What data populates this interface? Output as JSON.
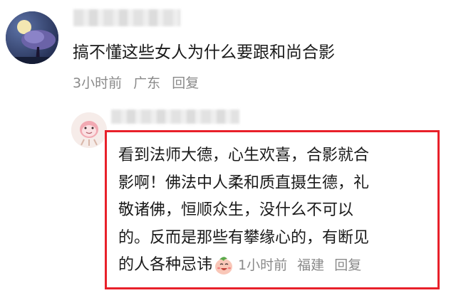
{
  "main_comment": {
    "text": "搞不懂这些女人为什么要跟和尚合影",
    "meta": {
      "time": "3小时前",
      "location": "广东",
      "reply_label": "回复"
    },
    "avatar_icon": "night-tree-avatar-icon"
  },
  "reply_comment": {
    "lines": [
      "看到法师大德，心生欢喜，合影就合",
      "影啊！佛法中人柔和质直摄生德，礼",
      "敬诸佛，恒顺众生，没什么不可以",
      "的。反而是那些有攀缘心的，有断见"
    ],
    "last_line": "的人各种忌讳",
    "emoji_icon": "shy-peach-emoji-icon",
    "meta": {
      "time": "1小时前",
      "location": "福建",
      "reply_label": "回复"
    },
    "avatar_icon": "cartoon-pink-avatar-icon"
  },
  "colors": {
    "highlight_border": "#e8202a",
    "meta_text": "#8a8a8a",
    "main_text": "#1a1a1a"
  }
}
